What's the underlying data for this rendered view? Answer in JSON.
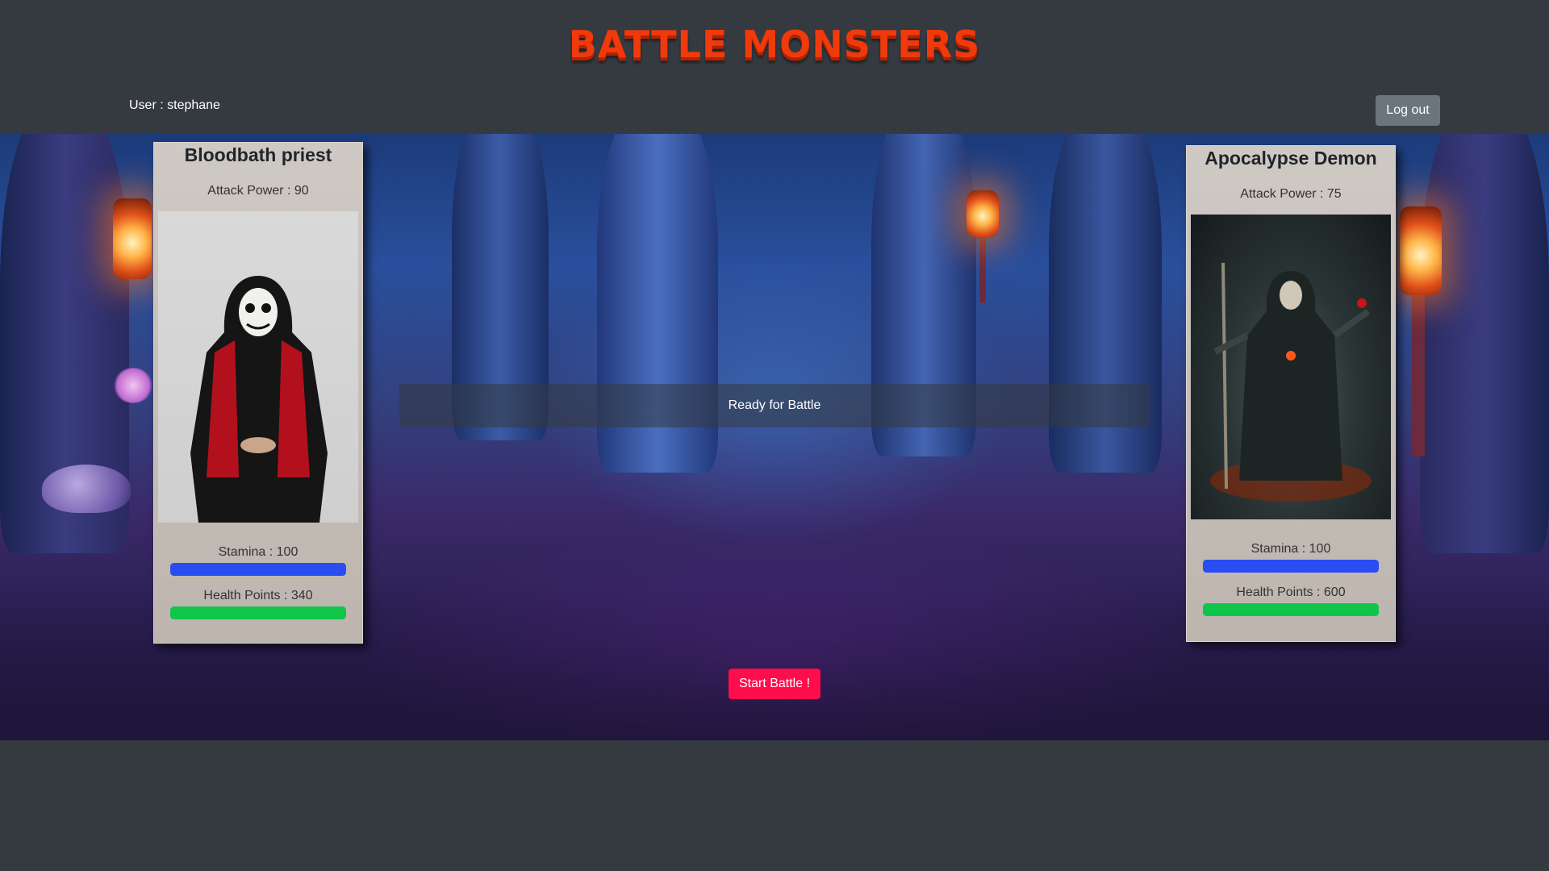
{
  "header": {
    "title": "BATTLE MONSTERS",
    "user_label": "User : stephane",
    "logout_label": "Log out"
  },
  "arena": {
    "status_text": "Ready for Battle",
    "start_label": "Start Battle !"
  },
  "monsters": [
    {
      "name": "Bloodbath priest",
      "attack_label": "Attack Power : 90",
      "stamina_label": "Stamina : 100",
      "stamina_fraction": 1.0,
      "health_label": "Health Points : 340",
      "health_fraction": 1.0
    },
    {
      "name": "Apocalypse Demon",
      "attack_label": "Attack Power : 75",
      "stamina_label": "Stamina : 100",
      "stamina_fraction": 1.0,
      "health_label": "Health Points : 600",
      "health_fraction": 1.0
    }
  ],
  "colors": {
    "title": "#f03a0c",
    "start_button": "#ff0d4d",
    "stamina_bar": "#2a4df2",
    "health_bar": "#0fc64a",
    "logout_button": "#6c757d"
  }
}
